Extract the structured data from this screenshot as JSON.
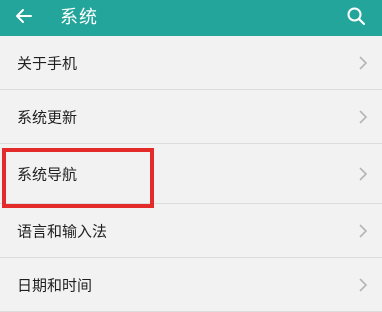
{
  "app_bar": {
    "title": "系统",
    "back_icon": "arrow-left-icon",
    "search_icon": "search-icon",
    "color": "#23a59b"
  },
  "settings": {
    "items": [
      {
        "label": "关于手机"
      },
      {
        "label": "系统更新"
      },
      {
        "label": "系统导航"
      },
      {
        "label": "语言和输入法"
      },
      {
        "label": "日期和时间"
      }
    ]
  },
  "annotation": {
    "highlighted_item": "系统导航",
    "color": "#e32b2b"
  }
}
